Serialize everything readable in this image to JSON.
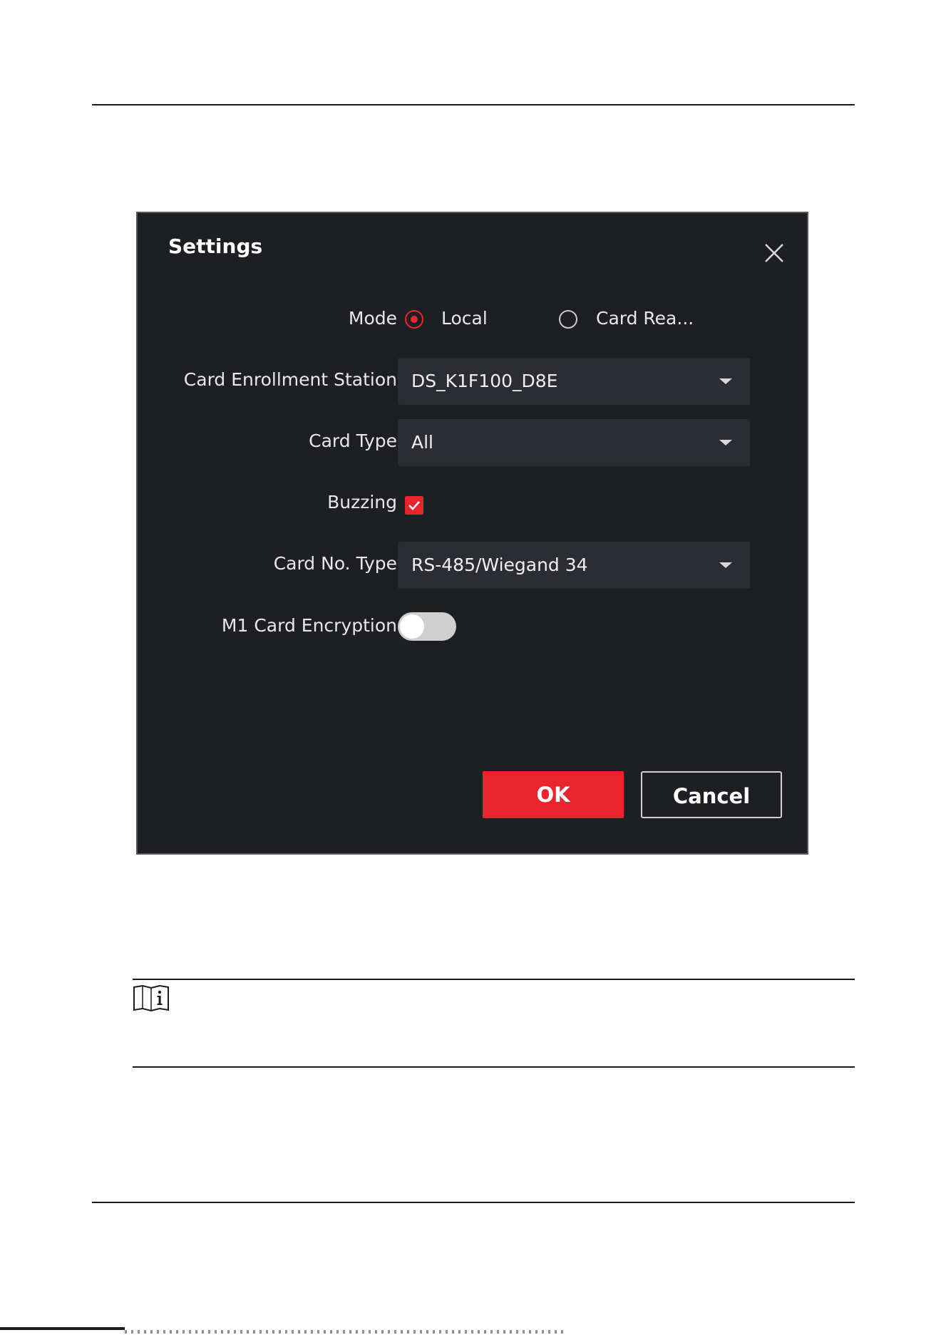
{
  "dialog": {
    "title": "Settings",
    "mode": {
      "label": "Mode",
      "options": [
        "Local",
        "Card Rea..."
      ],
      "selected": "Local"
    },
    "card_enrollment_station": {
      "label": "Card Enrollment Station",
      "value": "DS_K1F100_D8E"
    },
    "card_type": {
      "label": "Card Type",
      "value": "All"
    },
    "buzzing": {
      "label": "Buzzing",
      "checked": true
    },
    "card_no_type": {
      "label": "Card No. Type",
      "value": "RS-485/Wiegand 34"
    },
    "m1_card_encryption": {
      "label": "M1 Card Encryption",
      "enabled": false
    },
    "ok_label": "OK",
    "cancel_label": "Cancel"
  },
  "colors": {
    "accent": "#e8242f",
    "dialog_bg": "#1e1f23",
    "field_bg": "#2c2d33"
  },
  "icons": [
    "close-icon",
    "caret-down-icon",
    "check-icon",
    "note-info-icon"
  ]
}
